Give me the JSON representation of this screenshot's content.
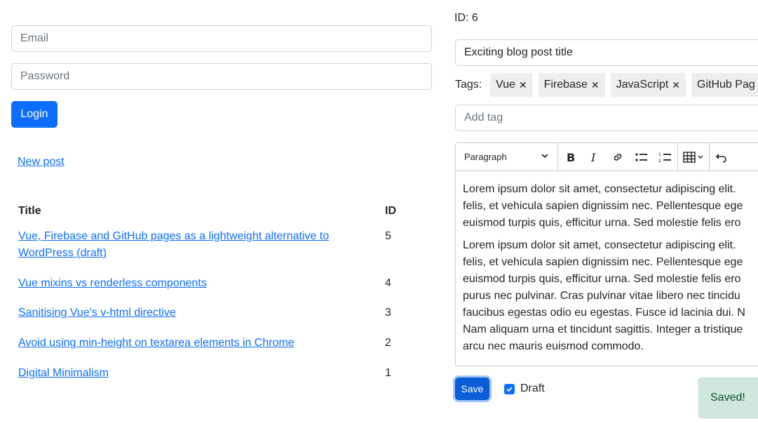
{
  "login": {
    "email_placeholder": "Email",
    "password_placeholder": "Password",
    "login_label": "Login"
  },
  "new_post_label": "New post",
  "posts": {
    "headers": {
      "title": "Title",
      "id": "ID"
    },
    "rows": [
      {
        "title": "Vue, Firebase and GitHub pages as a lightweight alternative to WordPress (draft)",
        "id": "5"
      },
      {
        "title": "Vue mixins vs renderless components",
        "id": "4"
      },
      {
        "title": "Sanitising Vue's v-html directive",
        "id": "3"
      },
      {
        "title": "Avoid using min-height on textarea elements in Chrome",
        "id": "2"
      },
      {
        "title": "Digital Minimalism",
        "id": "1"
      }
    ]
  },
  "editor": {
    "id_label": "ID: 6",
    "title_value": "Exciting blog post title",
    "tags_label": "Tags:",
    "tags": [
      "Vue",
      "Firebase",
      "JavaScript",
      "GitHub Pag"
    ],
    "add_tag_placeholder": "Add tag",
    "block_format": "Paragraph",
    "paragraph1": [
      "Lorem ipsum dolor sit amet, consectetur adipiscing elit.",
      "felis, et vehicula sapien dignissim nec. Pellentesque ege",
      "euismod turpis quis, efficitur urna. Sed molestie felis ero"
    ],
    "paragraph2": [
      "Lorem ipsum dolor sit amet, consectetur adipiscing elit.",
      "felis, et vehicula sapien dignissim nec. Pellentesque ege",
      "euismod turpis quis, efficitur urna. Sed molestie felis ero",
      "purus nec pulvinar. Cras pulvinar vitae libero nec tincidu",
      "faucibus egestas odio eu egestas. Fusce id lacinia dui. N",
      "Nam aliquam urna et tincidunt sagittis. Integer a tristique",
      "arcu nec mauris euismod commodo."
    ],
    "save_label": "Save",
    "draft_label": "Draft",
    "draft_checked": true,
    "toast_text": "Saved!"
  },
  "colors": {
    "primary": "#0d6efd",
    "toast_bg": "#d1e7dd",
    "toast_text": "#0f5132",
    "tag_bg": "#eeeeee"
  }
}
